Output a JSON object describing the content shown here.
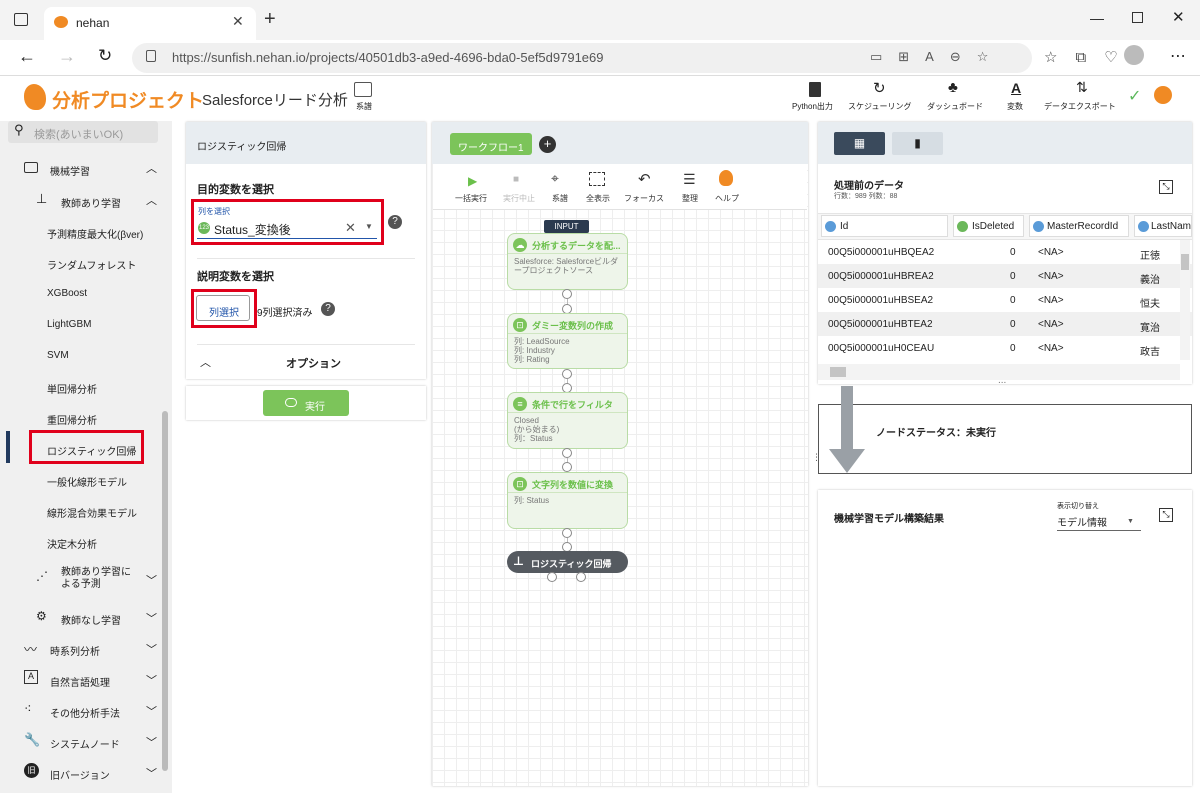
{
  "browser": {
    "tab_title": "nehan",
    "new_tab": "+",
    "url": "https://sunfish.nehan.io/projects/40501db3-a9ed-4696-bda0-5ef5d9791e69"
  },
  "header": {
    "brand": "分析プロジェクト",
    "project": "Salesforceリード分析",
    "lineage": "系譜",
    "tools": [
      {
        "label": "Python出力",
        "icon": "file-icon"
      },
      {
        "label": "スケジューリング",
        "icon": "refresh-icon"
      },
      {
        "label": "ダッシュボード",
        "icon": "tree-icon"
      },
      {
        "label": "変数",
        "icon": "a-icon"
      },
      {
        "label": "データエクスポート",
        "icon": "export-icon"
      }
    ]
  },
  "sidebar": {
    "search_placeholder": "検索(あいまいOK)",
    "items": [
      {
        "label": "機械学習"
      },
      {
        "label": "教師あり学習"
      },
      {
        "label": "予測精度最大化(βver)"
      },
      {
        "label": "ランダムフォレスト"
      },
      {
        "label": "XGBoost"
      },
      {
        "label": "LightGBM"
      },
      {
        "label": "SVM"
      },
      {
        "label": "単回帰分析"
      },
      {
        "label": "重回帰分析"
      },
      {
        "label": "ロジスティック回帰"
      },
      {
        "label": "一般化線形モデル"
      },
      {
        "label": "線形混合効果モデル"
      },
      {
        "label": "決定木分析"
      },
      {
        "label": "教師あり学習による予測"
      },
      {
        "label": "教師なし学習"
      },
      {
        "label": "時系列分析"
      },
      {
        "label": "自然言語処理"
      },
      {
        "label": "その他分析手法"
      },
      {
        "label": "システムノード"
      },
      {
        "label": "旧バージョン"
      }
    ]
  },
  "settings": {
    "title": "ロジスティック回帰",
    "target_heading": "目的変数を選択",
    "column_label": "列を選択",
    "column_value": "Status_変換後",
    "explanatory_heading": "説明変数を選択",
    "select_btn": "列選択",
    "selected_count": "9列選択済み",
    "options": "オプション",
    "run": "実行",
    "help": "?"
  },
  "workflow": {
    "tab": "ワークフロー1",
    "add": "+",
    "toolbar": [
      {
        "label": "一括実行"
      },
      {
        "label": "実行中止"
      },
      {
        "label": "系譜"
      },
      {
        "label": "全表示"
      },
      {
        "label": "フォーカス"
      },
      {
        "label": "整理"
      },
      {
        "label": "ヘルプ"
      }
    ],
    "input_tag": "INPUT",
    "nodes": [
      {
        "title": "分析するデータを配...",
        "body": "Salesforce: Salesforceビルダープロジェクトソース"
      },
      {
        "title": "ダミー変数列の作成",
        "body": "列: LeadSource\n列: Industry\n列: Rating"
      },
      {
        "title": "条件で行をフィルタ",
        "body": "Closed\n(から始まる)\n列：Status"
      },
      {
        "title": "文字列を数値に変換",
        "body": "列: Status"
      },
      {
        "title": "ロジスティック回帰",
        "body": ""
      }
    ]
  },
  "data_panel": {
    "title": "処理前のデータ",
    "stats": "行数：989 列数：88",
    "columns": [
      "Id",
      "IsDeleted",
      "MasterRecordId",
      "LastName"
    ],
    "rows": [
      [
        "00Q5i000001uHBQEA2",
        "0",
        "<NA>",
        "正徳"
      ],
      [
        "00Q5i000001uHBREA2",
        "0",
        "<NA>",
        "義治"
      ],
      [
        "00Q5i000001uHBSEA2",
        "0",
        "<NA>",
        "恒夫"
      ],
      [
        "00Q5i000001uHBTEA2",
        "0",
        "<NA>",
        "寛治"
      ],
      [
        "00Q5i000001uH0CEAU",
        "0",
        "<NA>",
        "政吉"
      ]
    ],
    "ellipsis": "..."
  },
  "status": {
    "text": "ノードステータス：未実行"
  },
  "results": {
    "title": "機械学習モデル構築結果",
    "switch_label": "表示切り替え",
    "switch_value": "モデル情報"
  }
}
